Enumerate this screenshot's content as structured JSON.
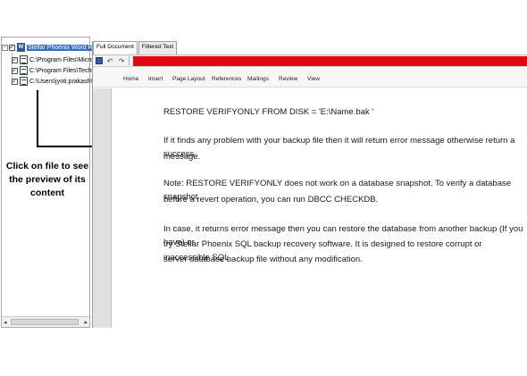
{
  "tree": {
    "root_label": "Stellar Phoenix Word Repai",
    "children": [
      "C:\\Program Files\\Micro",
      "C:\\Program Files\\Techs",
      "C:\\Users\\jyoti.prakash\\"
    ]
  },
  "callout": {
    "text": "Click on file to see the preview of its content"
  },
  "tabs": [
    "Full Document",
    "Filtered Text"
  ],
  "toolbar": {
    "undo_icon": "↶",
    "redo_icon": "↷",
    "more_icon": "▾"
  },
  "menu": [
    "Home",
    "Insert",
    "Page Layout",
    "References",
    "Mailings",
    "Review",
    "View"
  ],
  "document": {
    "line1": "RESTORE VERIFYONLY FROM DISK = 'E:\\Name.bak '",
    "para1_line1": "If it finds any problem with your backup file then it will return error message otherwise return a success",
    "para1_line2": "message.",
    "para2_line1": "Note: RESTORE VERIFYONLY does not work on a database snapshot. To verify a database snapshot",
    "para2_line2": "before a revert operation, you can run DBCC CHECKDB.",
    "para3_line1": "In case, it returns error message then you can restore the database from another backup (If you have) or",
    "para3_line2": "try Stellar Phoenix SQL backup recovery software. It is designed to restore corrupt or inaccessible  SQL",
    "para3_line3": "server database backup file without any modification."
  },
  "colors": {
    "accent_red": "#e30613",
    "selection_blue": "#3470c5"
  }
}
